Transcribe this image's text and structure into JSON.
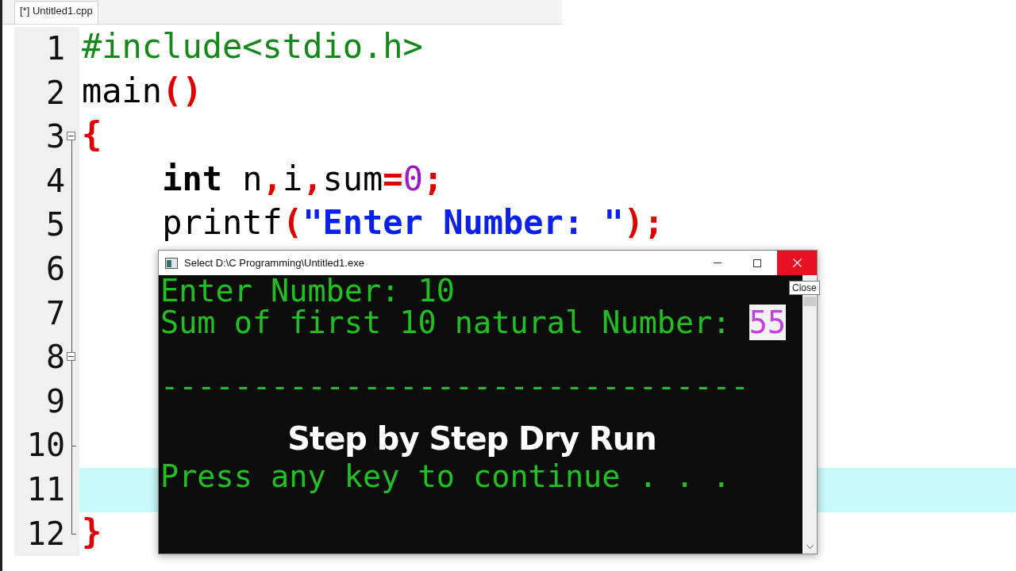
{
  "tab": {
    "label": "[*] Untitled1.cpp",
    "selected": true
  },
  "editor": {
    "lines": [
      {
        "number": "1",
        "fold_start": false,
        "fold_end": false,
        "current": false,
        "tokens": [
          {
            "kind": "preprocessor",
            "text": "#include<stdio.h>"
          }
        ]
      },
      {
        "number": "2",
        "fold_start": false,
        "fold_end": false,
        "current": false,
        "tokens": [
          {
            "kind": "plain",
            "text": "main"
          },
          {
            "kind": "operator",
            "text": "()"
          }
        ]
      },
      {
        "number": "3",
        "fold_start": true,
        "fold_end": false,
        "current": false,
        "tokens": [
          {
            "kind": "operator",
            "text": "{"
          }
        ]
      },
      {
        "number": "4",
        "fold_start": false,
        "fold_end": false,
        "current": false,
        "tokens": [
          {
            "kind": "keyword",
            "text": "    int"
          },
          {
            "kind": "plain",
            "text": " n"
          },
          {
            "kind": "operator",
            "text": ","
          },
          {
            "kind": "plain",
            "text": "i"
          },
          {
            "kind": "operator",
            "text": ","
          },
          {
            "kind": "plain",
            "text": "sum"
          },
          {
            "kind": "operator",
            "text": "="
          },
          {
            "kind": "number",
            "text": "0"
          },
          {
            "kind": "operator",
            "text": ";"
          }
        ]
      },
      {
        "number": "5",
        "fold_start": false,
        "fold_end": false,
        "current": false,
        "tokens": [
          {
            "kind": "plain",
            "text": "    printf"
          },
          {
            "kind": "operator",
            "text": "("
          },
          {
            "kind": "string",
            "text": "\"Enter Number: \""
          },
          {
            "kind": "operator",
            "text": ");"
          }
        ]
      },
      {
        "number": "6",
        "fold_start": false,
        "fold_end": false,
        "current": false
      },
      {
        "number": "7",
        "fold_start": false,
        "fold_end": false,
        "current": false
      },
      {
        "number": "8",
        "fold_start": true,
        "fold_end": false,
        "current": false
      },
      {
        "number": "9",
        "fold_start": false,
        "fold_end": false,
        "current": false
      },
      {
        "number": "10",
        "fold_start": false,
        "fold_end": true,
        "current": false
      },
      {
        "number": "11",
        "fold_start": false,
        "fold_end": false,
        "current": true
      },
      {
        "number": "12",
        "fold_start": false,
        "fold_end": true,
        "current": false,
        "tokens": [
          {
            "kind": "operator",
            "text": "}"
          }
        ]
      }
    ]
  },
  "console": {
    "title": "Select D:\\C Programming\\Untitled1.exe",
    "lines": [
      {
        "kind": "text",
        "segments": [
          {
            "text": "Enter Number: 10",
            "highlighted": false
          }
        ]
      },
      {
        "kind": "text",
        "segments": [
          {
            "text": "Sum of first 10 natural Number: ",
            "highlighted": false
          },
          {
            "text": "55",
            "highlighted": true
          }
        ]
      },
      {
        "kind": "rule",
        "segments": [
          {
            "text": "--------------------------------",
            "highlighted": false
          }
        ]
      }
    ],
    "caption": "Step by Step Dry Run",
    "prompt": "Press any key to continue . . .",
    "tooltip": "Close"
  }
}
